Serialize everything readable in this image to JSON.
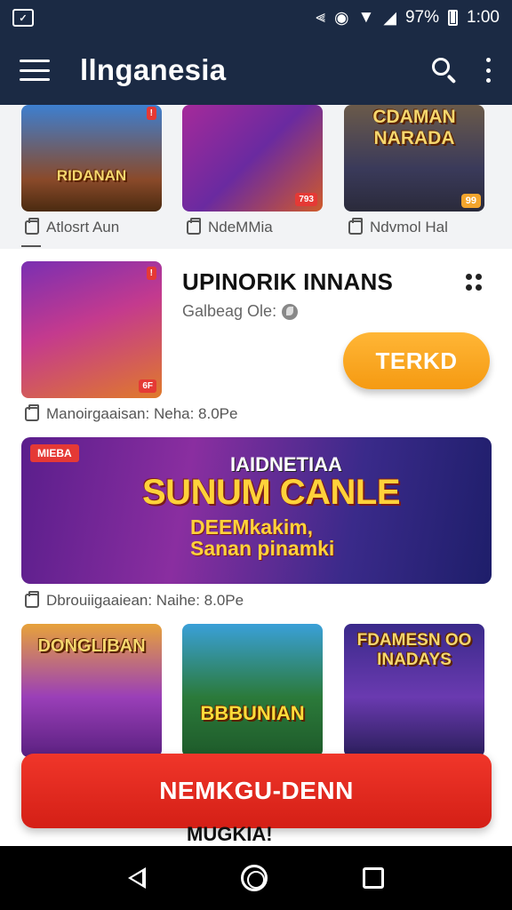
{
  "status_bar": {
    "battery": "97%",
    "time": "1:00",
    "icons": [
      "gallery-icon",
      "vibrate-icon",
      "circle-icon",
      "wifi-icon",
      "no-signal-icon",
      "battery-icon"
    ]
  },
  "app_bar": {
    "title": "llnganesia",
    "icons": [
      "menu-icon",
      "search-icon",
      "more-vert-icon"
    ]
  },
  "top_row": {
    "items": [
      {
        "art_text": "RIDANAN",
        "caption": "Atlosrt Aun"
      },
      {
        "art_text": "",
        "badge": "793",
        "caption": "NdeMMia"
      },
      {
        "art_text": "CDAMAN NARADA",
        "badge": "99",
        "caption": "Ndvmol Hal"
      }
    ]
  },
  "featured": {
    "title": "UPINORIK INNANS",
    "subtitle": "Galbeag Ole:",
    "button": "TERKD",
    "badge": "6F",
    "caption": "Manoirgaaisan: Neha: 8.0Pe"
  },
  "banner": {
    "tag": "MIEBA",
    "kicker": "IAIDNETIAA",
    "title": "SUNUM CANLE",
    "line1": "DEEMkakim,",
    "line2": "Sanan pinamki",
    "caption": "Dbrouiigaaiean: Naihe: 8.0Pe"
  },
  "bottom_row": {
    "items": [
      {
        "art_text": "DONGLIBAN"
      },
      {
        "art_text": "BBBUNIAN"
      },
      {
        "art_text": "FDAMESN OO INADAYS"
      }
    ]
  },
  "cta": {
    "label": "NEMKGU-DENN"
  },
  "below_text": "MUGKIA!",
  "colors": {
    "app_bar": "#1b2a44",
    "accent_orange": "#f59a12",
    "cta_red": "#e0281e"
  }
}
